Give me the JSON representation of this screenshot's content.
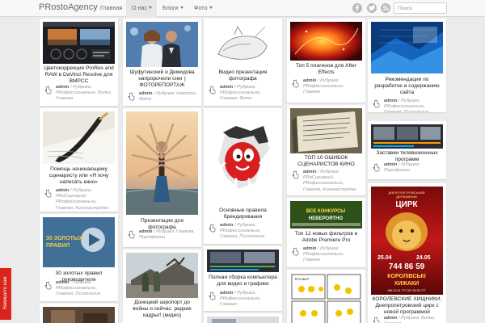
{
  "brand": "PRostoAgency",
  "nav": [
    {
      "label": "Главная",
      "dropdown": false,
      "active": false
    },
    {
      "label": "О нас",
      "dropdown": true,
      "active": true
    },
    {
      "label": "Блоги",
      "dropdown": true,
      "active": false
    },
    {
      "label": "Фото",
      "dropdown": true,
      "active": false
    }
  ],
  "social": [
    "facebook-icon",
    "twitter-icon",
    "rss-icon"
  ],
  "search": {
    "placeholder": "Поиск",
    "value": ""
  },
  "feedback": "Напишите нам",
  "colors": {
    "navbar": "#f8f8f8",
    "background": "#ebebeb",
    "feedback": "#d9241b",
    "meta": "#999999"
  },
  "posts": [
    {
      "title": "Цветокоррекция ProRes and RAW в DaVinci Resolve для BMPCC",
      "author": "admin",
      "tags": "Рубрика: PRофессионально, Видео, Главная"
    },
    {
      "title": "Помощь начинающему сценаристу или «Я хочу написать кино»",
      "author": "admin",
      "tags": "Рубрика: PRоСценарий, PRофессионально, Главная, Кинонастрядка"
    },
    {
      "title": "30 золотых правил руководителя",
      "author": "admin",
      "tags": "Рубрика: PRофессионально, Главная, Психология"
    },
    {
      "title": "Шуфутинский и Демидова напророчили снег | ФОТОРЕПОРТАЖ",
      "author": "admin",
      "tags": "Рубрика: Новости, Фото"
    },
    {
      "title": "Презентация для фотографа",
      "author": "admin",
      "tags": "Рубрика: Главная, Портфолио"
    },
    {
      "title": "Донецкий аэропорт до войны и сейчас: редкие кадры!! (видео)",
      "author": "",
      "tags": ""
    },
    {
      "title": "Видео презентация фотографа",
      "author": "admin",
      "tags": "Рубрика: PRофессионально, Главная, Фото"
    },
    {
      "title": "Основные правила брендирования",
      "author": "admin",
      "tags": "Рубрика: PRофессионально, Главная, Психология"
    },
    {
      "title": "Полная сборка компьютера для видео и графики",
      "author": "admin",
      "tags": "Рубрика: PRофессионально, Главная"
    },
    {
      "title": "Топ 5 плагинов для After Effects",
      "author": "admin",
      "tags": "Рубрика: PRофессионально, Главная"
    },
    {
      "title": "ТОП 10 ОШИБОК СЦЕНАРИСТОВ КИНО",
      "author": "admin",
      "tags": "Рубрика: PRоСценарий, PRофессионально, Главная, Кинонастрядка"
    },
    {
      "title": "Топ 12 новых фильтров в Adobe Premiere Pro",
      "author": "admin",
      "tags": "Рубрика: PRофессионально, Главная"
    },
    {
      "title": "Рекомендации по разработке и содержанию сайта",
      "author": "admin",
      "tags": "Рубрика: PRофессионально, Главная, Психология"
    },
    {
      "title": "Заставки телевизионных программ",
      "author": "admin",
      "tags": "Рубрика: Портфолио"
    },
    {
      "title": "КОРОЛЕВСКИЕ ХИЩНИКИ. Днепропетровский цирк с новой программой",
      "author": "admin",
      "tags": "Рубрика: Видео, Главная"
    }
  ],
  "image_text": {
    "prores": "ProRes • RAW",
    "golden_line1": "30 ЗОЛОТЫХ",
    "golden_line2": "ПРАВИЛ",
    "premiere_line1": "ВСЕ КОНКУРСЫ",
    "premiere_line2": "НЕВЕРОЯТНО",
    "circus_line1": "ДНІПРОПЕТРОВСЬКИЙ",
    "circus_line2": "ДЕРЖАВНИЙ",
    "circus_big": "ЦИРК",
    "circus_date1": "25.04",
    "circus_date2": "24.05",
    "circus_phone": "744 86 59",
    "circus_title1": "КОРОЛІВСЬКІ",
    "circus_title2": "ХИЖАКИ",
    "circus_phones": "066 13 01 777  097 39 35 777",
    "comic_label": "Кто мы?"
  }
}
